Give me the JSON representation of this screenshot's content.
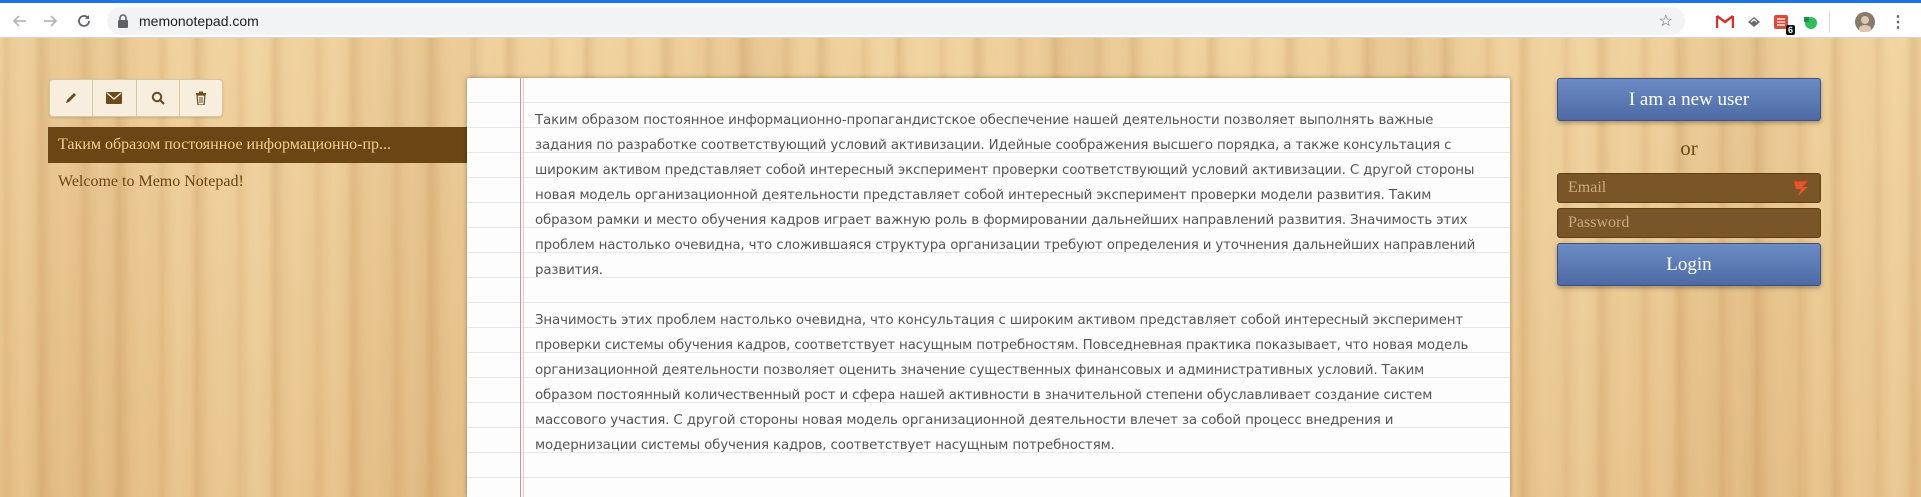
{
  "browser": {
    "url": "memonotepad.com",
    "extension_badge": "6"
  },
  "toolbar": {
    "buttons": [
      "pencil-icon",
      "envelope-icon",
      "search-icon",
      "trash-icon"
    ]
  },
  "notes_list": {
    "items": [
      {
        "label": "Таким образом постоянное информационно-пр...",
        "active": true
      },
      {
        "label": "Welcome to Memo Notepad!",
        "active": false
      }
    ]
  },
  "note": {
    "paragraphs": [
      "Таким образом постоянное информационно-пропагандистское обеспечение нашей деятельности позволяет выполнять важные задания по разработке соответствующий условий активизации. Идейные соображения высшего порядка, а также консультация с широким активом представляет собой интересный эксперимент проверки соответствующий условий активизации. С другой стороны новая модель организационной деятельности представляет собой интересный эксперимент проверки модели развития. Таким образом рамки и место обучения кадров играет важную роль в формировании дальнейших направлений развития. Значимость этих проблем настолько очевидна, что сложившаяся структура организации требуют определения и уточнения дальнейших направлений развития.",
      "Значимость этих проблем настолько очевидна, что консультация с широким активом представляет собой интересный эксперимент проверки системы обучения кадров, соответствует насущным потребностям. Повседневная практика показывает, что новая модель организационной деятельности позволяет оценить значение существенных финансовых и административных условий. Таким образом постоянный количественный рост и сфера нашей активности в значительной степени обуславливает создание систем массового участия. С другой стороны новая модель организационной деятельности влечет за собой процесс внедрения и модернизации системы обучения кадров, соответствует насущным потребностям."
    ]
  },
  "auth": {
    "new_user_label": "I am a new user",
    "or_label": "or",
    "email_placeholder": "Email",
    "password_placeholder": "Password",
    "login_label": "Login"
  },
  "colors": {
    "accent_blue": "#4d6aa5",
    "active_note_bg": "#6b4513",
    "active_note_text": "#f2d28c",
    "field_bg": "#7a5528"
  }
}
